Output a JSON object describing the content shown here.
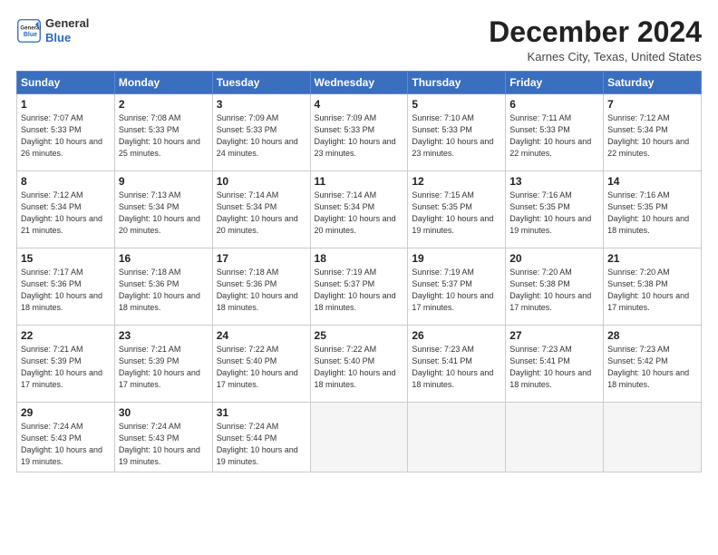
{
  "logo": {
    "general": "General",
    "blue": "Blue"
  },
  "title": "December 2024",
  "location": "Karnes City, Texas, United States",
  "days_of_week": [
    "Sunday",
    "Monday",
    "Tuesday",
    "Wednesday",
    "Thursday",
    "Friday",
    "Saturday"
  ],
  "weeks": [
    [
      {
        "day": "1",
        "sunrise": "7:07 AM",
        "sunset": "5:33 PM",
        "daylight": "10 hours and 26 minutes."
      },
      {
        "day": "2",
        "sunrise": "7:08 AM",
        "sunset": "5:33 PM",
        "daylight": "10 hours and 25 minutes."
      },
      {
        "day": "3",
        "sunrise": "7:09 AM",
        "sunset": "5:33 PM",
        "daylight": "10 hours and 24 minutes."
      },
      {
        "day": "4",
        "sunrise": "7:09 AM",
        "sunset": "5:33 PM",
        "daylight": "10 hours and 23 minutes."
      },
      {
        "day": "5",
        "sunrise": "7:10 AM",
        "sunset": "5:33 PM",
        "daylight": "10 hours and 23 minutes."
      },
      {
        "day": "6",
        "sunrise": "7:11 AM",
        "sunset": "5:33 PM",
        "daylight": "10 hours and 22 minutes."
      },
      {
        "day": "7",
        "sunrise": "7:12 AM",
        "sunset": "5:34 PM",
        "daylight": "10 hours and 22 minutes."
      }
    ],
    [
      {
        "day": "8",
        "sunrise": "7:12 AM",
        "sunset": "5:34 PM",
        "daylight": "10 hours and 21 minutes."
      },
      {
        "day": "9",
        "sunrise": "7:13 AM",
        "sunset": "5:34 PM",
        "daylight": "10 hours and 20 minutes."
      },
      {
        "day": "10",
        "sunrise": "7:14 AM",
        "sunset": "5:34 PM",
        "daylight": "10 hours and 20 minutes."
      },
      {
        "day": "11",
        "sunrise": "7:14 AM",
        "sunset": "5:34 PM",
        "daylight": "10 hours and 20 minutes."
      },
      {
        "day": "12",
        "sunrise": "7:15 AM",
        "sunset": "5:35 PM",
        "daylight": "10 hours and 19 minutes."
      },
      {
        "day": "13",
        "sunrise": "7:16 AM",
        "sunset": "5:35 PM",
        "daylight": "10 hours and 19 minutes."
      },
      {
        "day": "14",
        "sunrise": "7:16 AM",
        "sunset": "5:35 PM",
        "daylight": "10 hours and 18 minutes."
      }
    ],
    [
      {
        "day": "15",
        "sunrise": "7:17 AM",
        "sunset": "5:36 PM",
        "daylight": "10 hours and 18 minutes."
      },
      {
        "day": "16",
        "sunrise": "7:18 AM",
        "sunset": "5:36 PM",
        "daylight": "10 hours and 18 minutes."
      },
      {
        "day": "17",
        "sunrise": "7:18 AM",
        "sunset": "5:36 PM",
        "daylight": "10 hours and 18 minutes."
      },
      {
        "day": "18",
        "sunrise": "7:19 AM",
        "sunset": "5:37 PM",
        "daylight": "10 hours and 18 minutes."
      },
      {
        "day": "19",
        "sunrise": "7:19 AM",
        "sunset": "5:37 PM",
        "daylight": "10 hours and 17 minutes."
      },
      {
        "day": "20",
        "sunrise": "7:20 AM",
        "sunset": "5:38 PM",
        "daylight": "10 hours and 17 minutes."
      },
      {
        "day": "21",
        "sunrise": "7:20 AM",
        "sunset": "5:38 PM",
        "daylight": "10 hours and 17 minutes."
      }
    ],
    [
      {
        "day": "22",
        "sunrise": "7:21 AM",
        "sunset": "5:39 PM",
        "daylight": "10 hours and 17 minutes."
      },
      {
        "day": "23",
        "sunrise": "7:21 AM",
        "sunset": "5:39 PM",
        "daylight": "10 hours and 17 minutes."
      },
      {
        "day": "24",
        "sunrise": "7:22 AM",
        "sunset": "5:40 PM",
        "daylight": "10 hours and 17 minutes."
      },
      {
        "day": "25",
        "sunrise": "7:22 AM",
        "sunset": "5:40 PM",
        "daylight": "10 hours and 18 minutes."
      },
      {
        "day": "26",
        "sunrise": "7:23 AM",
        "sunset": "5:41 PM",
        "daylight": "10 hours and 18 minutes."
      },
      {
        "day": "27",
        "sunrise": "7:23 AM",
        "sunset": "5:41 PM",
        "daylight": "10 hours and 18 minutes."
      },
      {
        "day": "28",
        "sunrise": "7:23 AM",
        "sunset": "5:42 PM",
        "daylight": "10 hours and 18 minutes."
      }
    ],
    [
      {
        "day": "29",
        "sunrise": "7:24 AM",
        "sunset": "5:43 PM",
        "daylight": "10 hours and 19 minutes."
      },
      {
        "day": "30",
        "sunrise": "7:24 AM",
        "sunset": "5:43 PM",
        "daylight": "10 hours and 19 minutes."
      },
      {
        "day": "31",
        "sunrise": "7:24 AM",
        "sunset": "5:44 PM",
        "daylight": "10 hours and 19 minutes."
      },
      null,
      null,
      null,
      null
    ]
  ]
}
